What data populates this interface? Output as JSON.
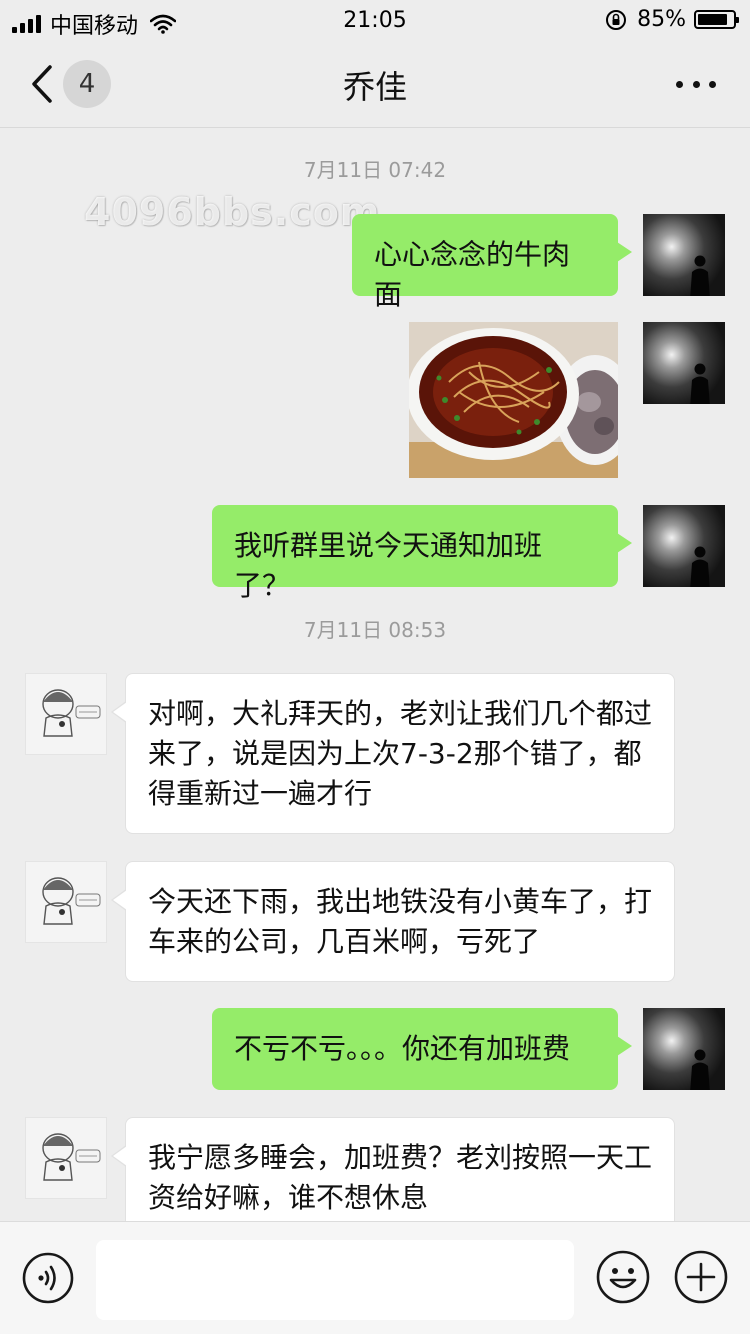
{
  "status_bar": {
    "carrier": "中国移动",
    "time": "21:05",
    "battery_percent": "85%",
    "battery_level": 0.85
  },
  "nav": {
    "unread_count": "4",
    "title": "乔佳"
  },
  "watermark": "4096bbs.com",
  "timestamps": [
    "7月11日 07:42",
    "7月11日 08:53"
  ],
  "messages": [
    {
      "sender": "me",
      "type": "text",
      "text": "心心念念的牛肉面"
    },
    {
      "sender": "me",
      "type": "image",
      "image": "beef-noodle-photo"
    },
    {
      "sender": "me",
      "type": "text",
      "text": "我听群里说今天通知加班了？"
    },
    {
      "sender": "other",
      "type": "text",
      "text": "对啊，大礼拜天的，老刘让我们几个都过来了，说是因为上次7-3-2那个错了，都得重新过一遍才行"
    },
    {
      "sender": "other",
      "type": "text",
      "text": "今天还下雨，我出地铁没有小黄车了，打车来的公司，几百米啊，亏死了"
    },
    {
      "sender": "me",
      "type": "text",
      "text": "不亏不亏。。。你还有加班费"
    },
    {
      "sender": "other",
      "type": "text",
      "text": "我宁愿多睡会，加班费？老刘按照一天工资给好嘛，谁不想休息"
    }
  ],
  "input_bar": {
    "input_value": "",
    "icons": [
      "voice-icon",
      "emoji-icon",
      "plus-icon"
    ]
  },
  "colors": {
    "my_bubble": "#95ec69",
    "other_bubble": "#ffffff",
    "background": "#ededed"
  }
}
